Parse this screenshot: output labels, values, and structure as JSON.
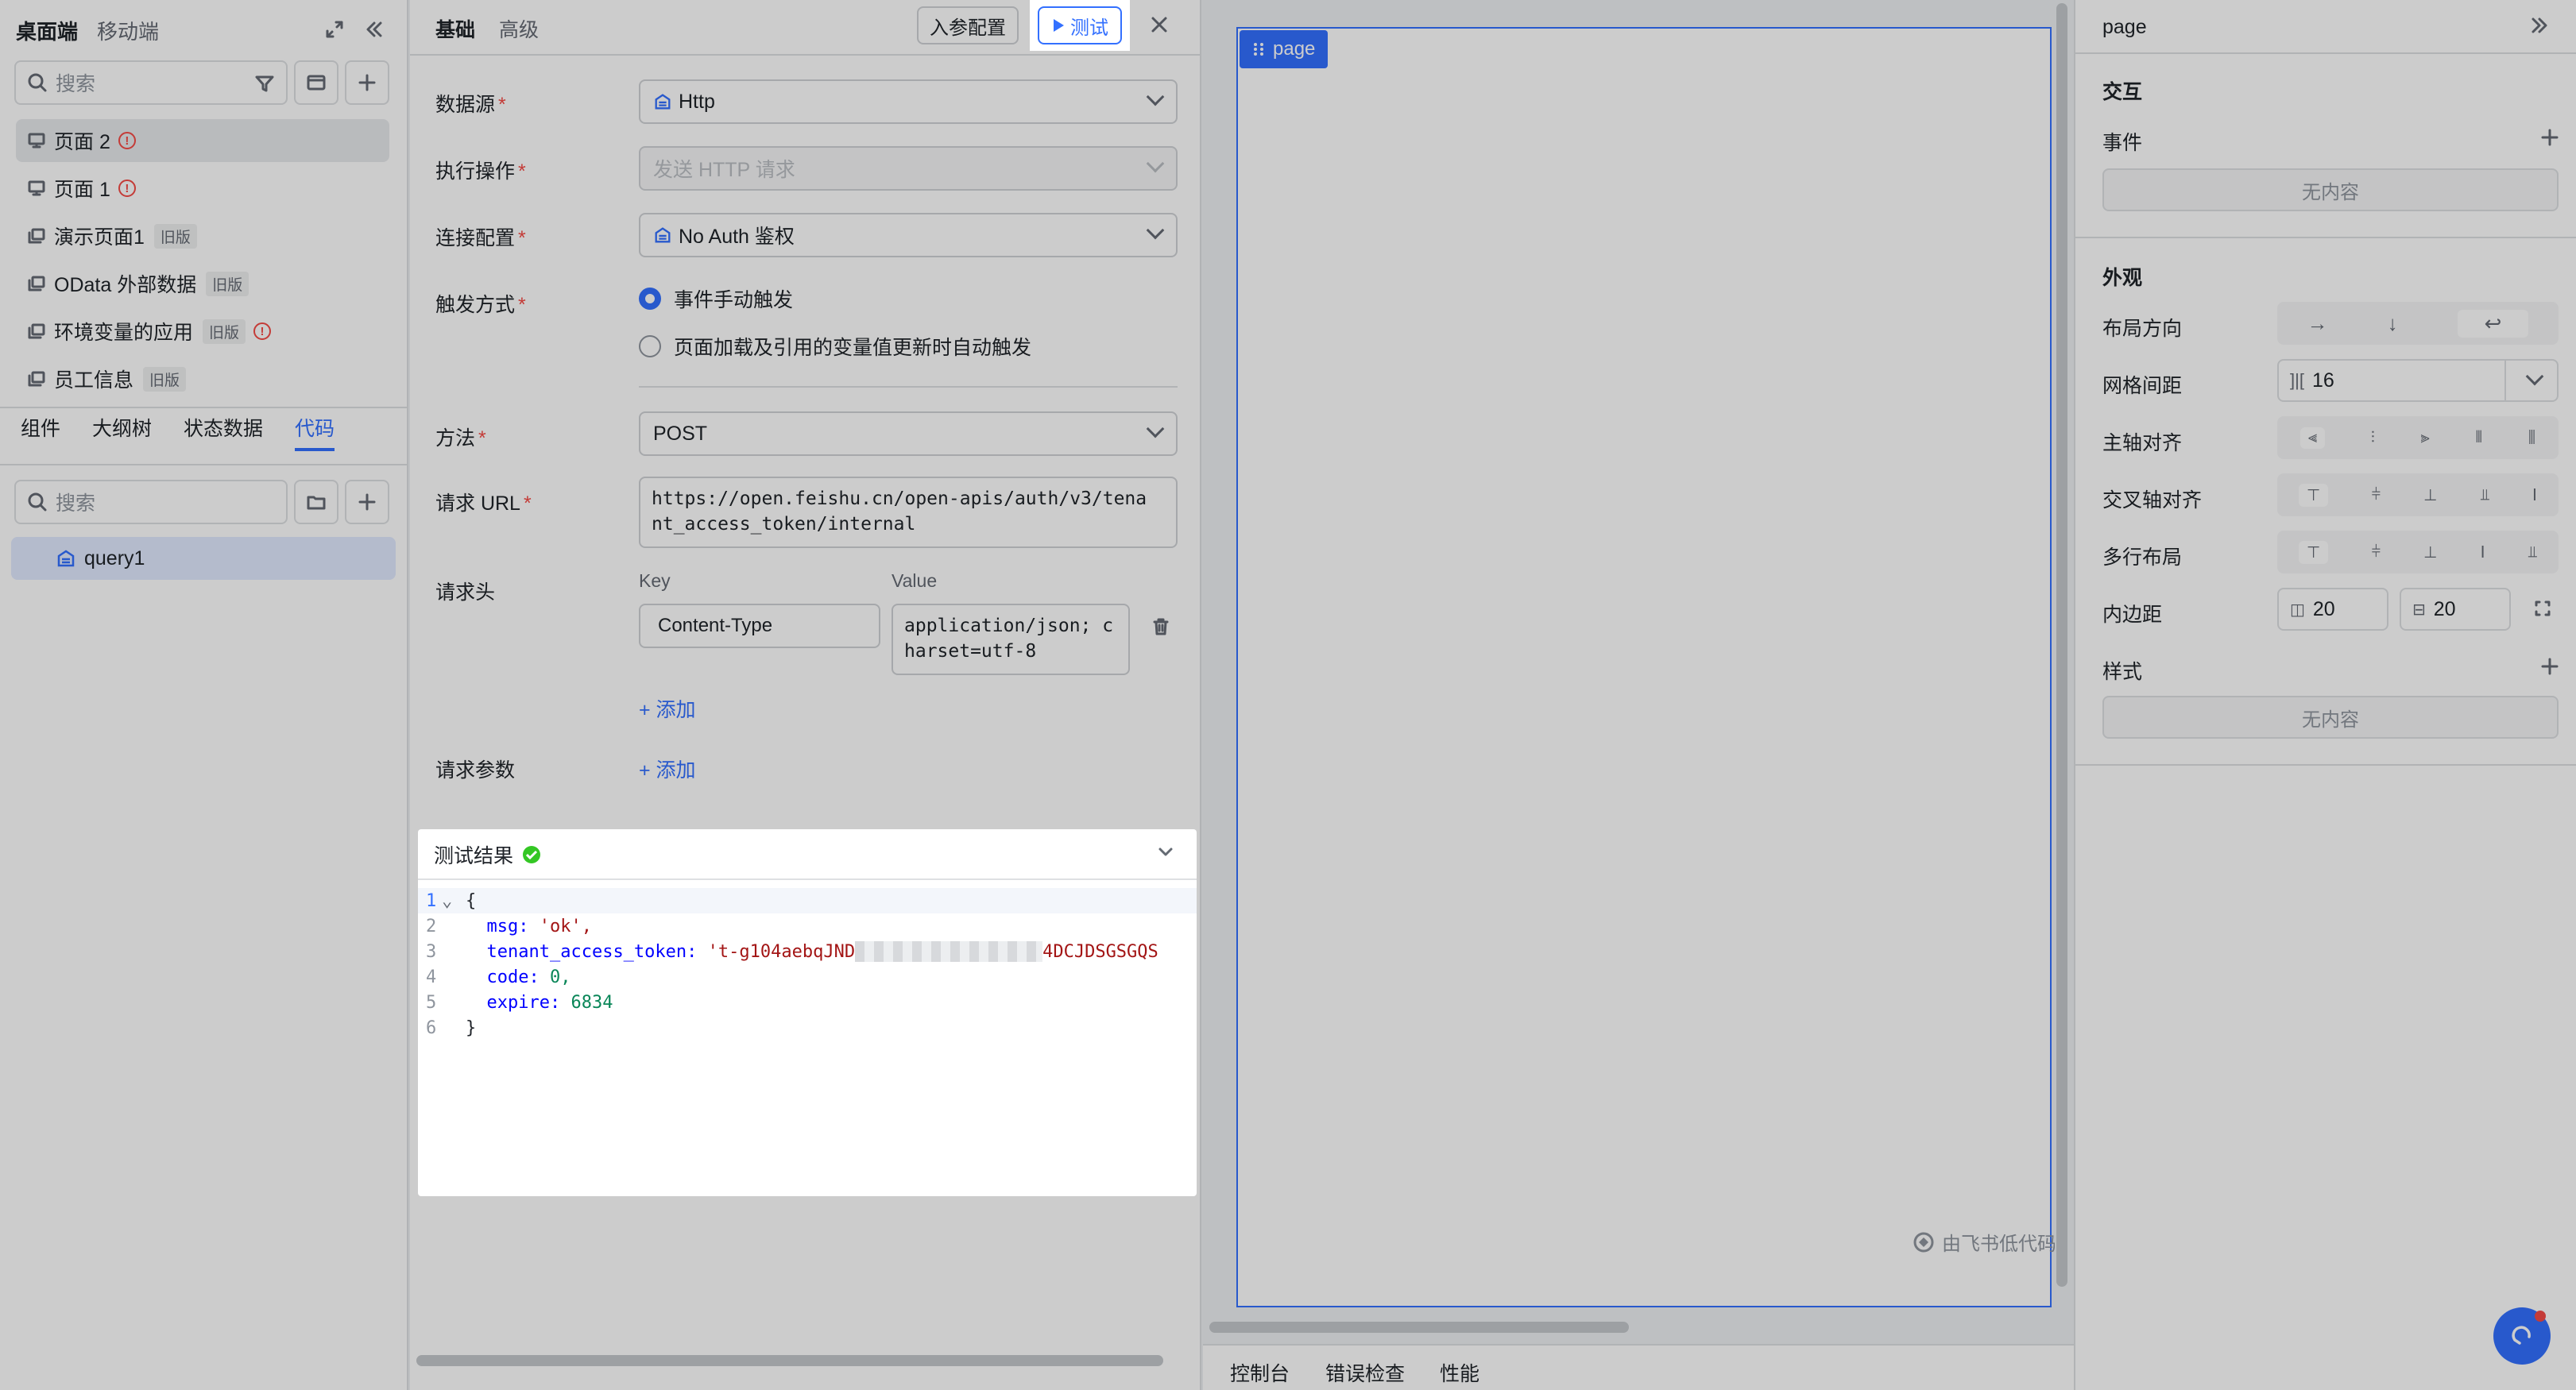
{
  "sidebar": {
    "top_tabs": [
      "桌面端",
      "移动端"
    ],
    "search_placeholder": "搜索",
    "pages": [
      {
        "label": "页面 2",
        "badge": "",
        "warn": "!"
      },
      {
        "label": "页面 1",
        "badge": "",
        "warn": "!"
      },
      {
        "label": "演示页面1",
        "badge": "旧版",
        "warn": ""
      },
      {
        "label": "OData 外部数据",
        "badge": "旧版",
        "warn": ""
      },
      {
        "label": "环境变量的应用",
        "badge": "旧版",
        "warn": "!"
      },
      {
        "label": "员工信息",
        "badge": "旧版",
        "warn": ""
      }
    ],
    "sub_tabs": [
      "组件",
      "大纲树",
      "状态数据",
      "代码"
    ],
    "code_search_placeholder": "搜索",
    "query_item": "query1"
  },
  "panel": {
    "tabs": [
      "基础",
      "高级"
    ],
    "param_config": "入参配置",
    "test_button": "测试",
    "fields": {
      "datasource_label": "数据源",
      "datasource_value": "Http",
      "operation_label": "执行操作",
      "operation_value": "发送 HTTP 请求",
      "connection_label": "连接配置",
      "connection_value": "No Auth 鉴权",
      "trigger_label": "触发方式",
      "trigger_option1": "事件手动触发",
      "trigger_option2": "页面加载及引用的变量值更新时自动触发",
      "method_label": "方法",
      "method_value": "POST",
      "url_label": "请求 URL",
      "url_line1": "https://open.feishu.cn/open-apis/auth/v3/tena",
      "url_line2": "nt_access_token/internal",
      "headers_label": "请求头",
      "key_col": "Key",
      "value_col": "Value",
      "header_key": "Content-Type",
      "header_value_line1": "application/json; c",
      "header_value_line2": "harset=utf-8",
      "add_link": "添加",
      "params_label": "请求参数"
    },
    "results": {
      "title": "测试结果",
      "lines": [
        "1",
        "2",
        "3",
        "4",
        "5",
        "6"
      ],
      "open_brace": "{",
      "close_brace": "}",
      "msg_key": "msg:",
      "msg_val": "'ok',",
      "token_key": "tenant_access_token:",
      "token_val_a": "'t-g104aebqJND",
      "token_val_b": "4DCJDSGSGQS",
      "code_key": "code:",
      "code_val": "0,",
      "expire_key": "expire:",
      "expire_val": "6834"
    }
  },
  "canvas": {
    "page_tag": "page",
    "watermark": "由飞书低代码",
    "bottom_tabs": [
      "控制台",
      "错误检查",
      "性能"
    ]
  },
  "right": {
    "title": "page",
    "interaction": "交互",
    "events": "事件",
    "empty": "无内容",
    "appearance": "外观",
    "layout_direction": "布局方向",
    "grid_gap": "网格间距",
    "grid_gap_value": "16",
    "main_axis": "主轴对齐",
    "cross_axis": "交叉轴对齐",
    "multi_line": "多行布局",
    "padding": "内边距",
    "padding_a": "20",
    "padding_b": "20",
    "style": "样式"
  },
  "colors": {
    "accent": "#3370ff",
    "warn": "#f54a45",
    "success": "#34c724"
  }
}
